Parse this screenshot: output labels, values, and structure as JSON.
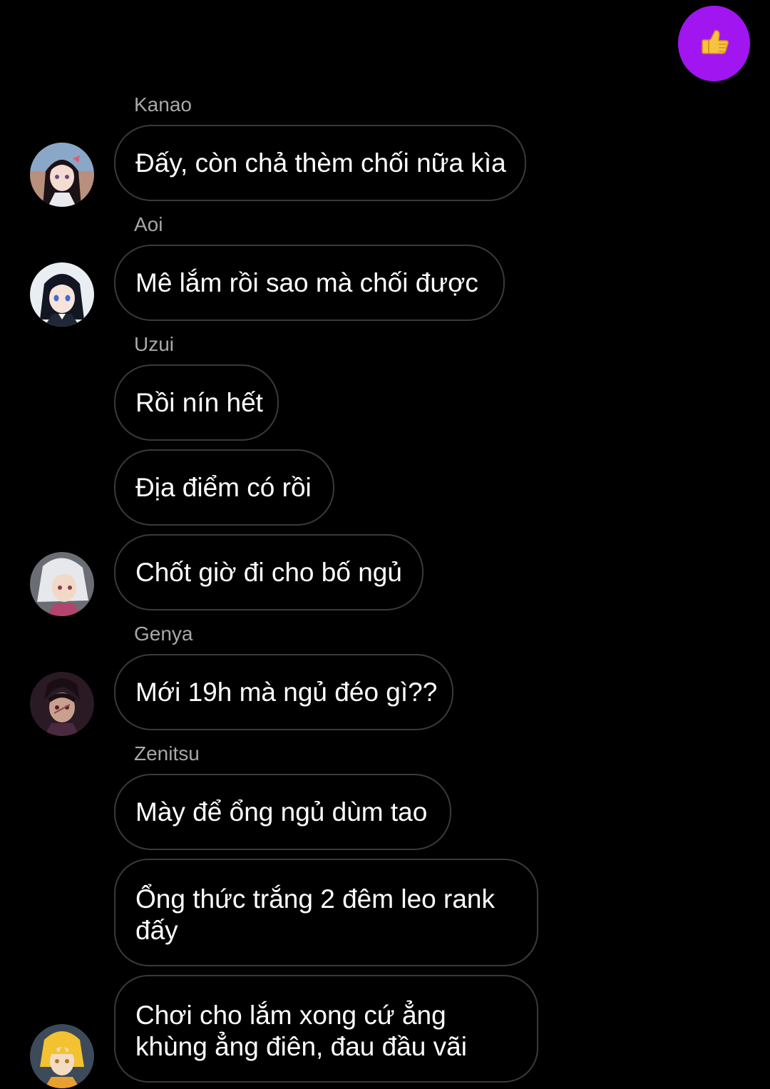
{
  "like_button": {
    "icon": "thumbs-up-icon",
    "color": "#a116f0"
  },
  "messages": [
    {
      "sender": "Kanao",
      "text": "Đấy, còn chả thèm chối nữa kìa",
      "avatar": "avatar-kanao"
    },
    {
      "sender": "Aoi",
      "text": "Mê lắm rồi sao mà chối được",
      "avatar": "avatar-aoi"
    },
    {
      "sender": "Uzui",
      "text": "Rồi nín hết"
    },
    {
      "text": "Địa điểm có rồi"
    },
    {
      "text": "Chốt giờ đi cho bố ngủ",
      "avatar": "avatar-uzui"
    },
    {
      "sender": "Genya",
      "text": "Mới 19h mà ngủ đéo gì??",
      "avatar": "avatar-genya"
    },
    {
      "sender": "Zenitsu",
      "text": "Mày để ổng ngủ dùm tao"
    },
    {
      "text_lines": [
        "Ổng thức trắng 2 đêm leo rank",
        "đấy"
      ]
    },
    {
      "text_lines": [
        "Chơi cho lắm xong cứ ẳng",
        "khùng ẳng điên, đau đầu vãi"
      ],
      "avatar": "avatar-zenitsu"
    }
  ],
  "colors": {
    "background": "#000000",
    "bubble_border": "#3a3a3a",
    "sender_name": "#a8a8a8",
    "message_text": "#ffffff"
  }
}
